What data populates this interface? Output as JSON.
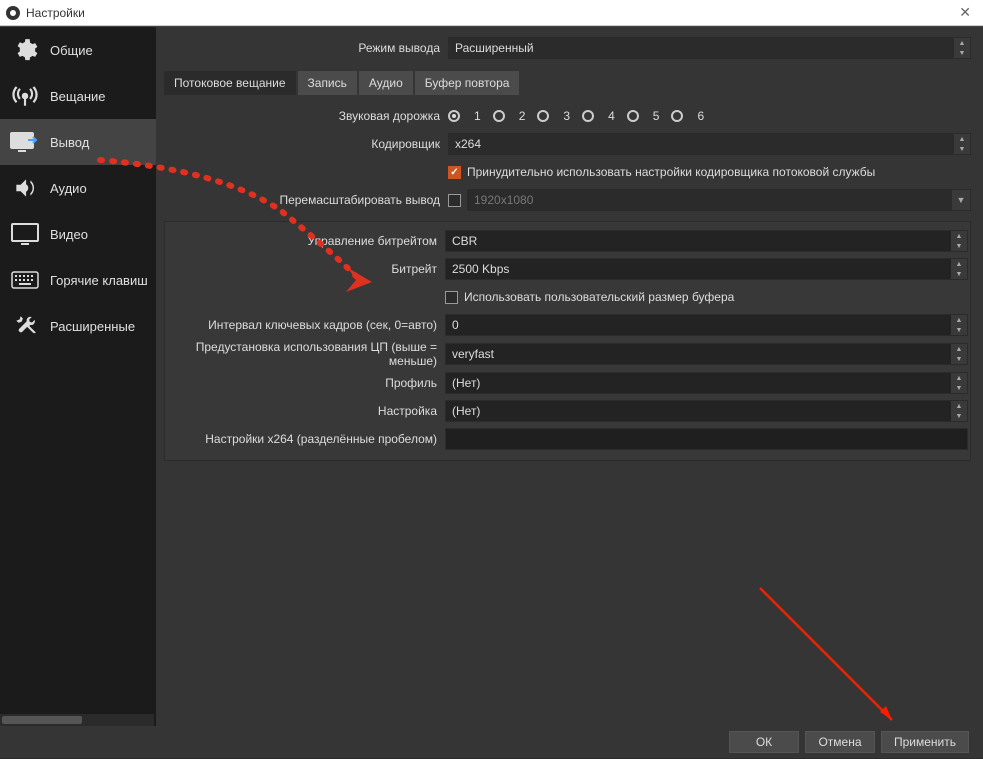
{
  "window": {
    "title": "Настройки"
  },
  "sidebar": {
    "items": [
      {
        "label": "Общие",
        "icon": "gear-icon"
      },
      {
        "label": "Вещание",
        "icon": "broadcast-icon"
      },
      {
        "label": "Вывод",
        "icon": "output-icon",
        "selected": true
      },
      {
        "label": "Аудио",
        "icon": "audio-icon"
      },
      {
        "label": "Видео",
        "icon": "video-icon"
      },
      {
        "label": "Горячие клавиш",
        "icon": "hotkeys-icon"
      },
      {
        "label": "Расширенные",
        "icon": "advanced-icon"
      }
    ]
  },
  "output_mode": {
    "label": "Режим вывода",
    "value": "Расширенный"
  },
  "tabs": [
    {
      "label": "Потоковое вещание",
      "active": true
    },
    {
      "label": "Запись"
    },
    {
      "label": "Аудио"
    },
    {
      "label": "Буфер повтора"
    }
  ],
  "streaming": {
    "audio_track": {
      "label": "Звуковая дорожка",
      "options": [
        "1",
        "2",
        "3",
        "4",
        "5",
        "6"
      ],
      "selected": "1"
    },
    "encoder": {
      "label": "Кодировщик",
      "value": "x264"
    },
    "enforce": {
      "value": true,
      "label": "Принудительно использовать настройки кодировщика потоковой службы"
    },
    "rescale": {
      "label": "Перемасштабировать вывод",
      "checked": false,
      "value_placeholder": "1920x1080"
    },
    "rate_control": {
      "label": "Управление битрейтом",
      "value": "CBR"
    },
    "bitrate": {
      "label": "Битрейт",
      "value": "2500 Kbps"
    },
    "custom_buffer": {
      "checked": false,
      "label": "Использовать пользовательский размер буфера"
    },
    "keyint": {
      "label": "Интервал ключевых кадров (сек, 0=авто)",
      "value": "0"
    },
    "cpu_preset": {
      "label": "Предустановка использования ЦП (выше = меньше)",
      "value": "veryfast"
    },
    "profile": {
      "label": "Профиль",
      "value": "(Нет)"
    },
    "tune": {
      "label": "Настройка",
      "value": "(Нет)"
    },
    "x264opts": {
      "label": "Настройки x264 (разделённые пробелом)",
      "value": ""
    }
  },
  "buttons": {
    "ok": "ОК",
    "cancel": "Отмена",
    "apply": "Применить"
  }
}
